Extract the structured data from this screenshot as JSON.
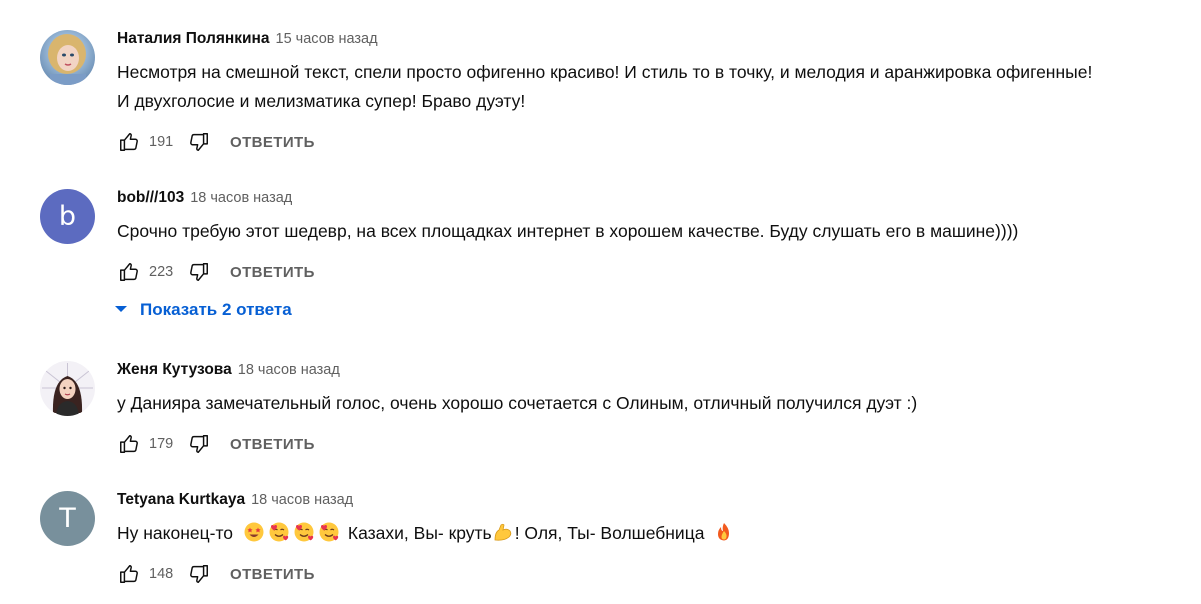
{
  "reply_label": "ОТВЕТИТЬ",
  "show_replies_label": "Показать 2 ответа",
  "comments": [
    {
      "author": "Наталия Полянкина",
      "time": "15 часов назад",
      "text_lines": [
        "Несмотря на смешной текст, спели просто офигенно красиво! И стиль то в точку, и мелодия и аранжировка офигенные!",
        "И двухголосие и мелизматика супер! Браво дуэту!"
      ],
      "likes": "191",
      "avatar": {
        "type": "photo",
        "icon": "woman-portrait-photo"
      }
    },
    {
      "author": "bob///103",
      "time": "18 часов назад",
      "text_lines": [
        "Срочно требую этот шедевр, на всех площадках интернет в хорошем качестве. Буду слушать его в машине))))"
      ],
      "likes": "223",
      "avatar": {
        "type": "letter",
        "letter": "b",
        "color": "#5c6bc0"
      }
    },
    {
      "author": "Женя Кутузова",
      "time": "18 часов назад",
      "text_lines": [
        "у Данияра замечательный голос, очень хорошо сочетается с Олиным, отличный получился дуэт :)"
      ],
      "likes": "179",
      "avatar": {
        "type": "drawing",
        "icon": "girl-illustration"
      }
    },
    {
      "author": "Tetyana Kurtkaya",
      "time": "18 часов назад",
      "text_parts": [
        "Ну наконец-то",
        "Казахи, Вы- круть",
        "! Оля, Ты- Волшебница"
      ],
      "emojis": [
        "star-struck-emoji",
        "smiling-face-with-hearts-emoji",
        "smiling-face-with-hearts-emoji",
        "smiling-face-with-hearts-emoji",
        "flexed-biceps-emoji",
        "fire-emoji"
      ],
      "likes": "148",
      "avatar": {
        "type": "letter",
        "letter": "T",
        "color": "#78909c"
      }
    }
  ],
  "icons": {
    "like": "thumbs-up-icon",
    "dislike": "thumbs-down-icon",
    "expand": "caret-down-icon"
  },
  "colors": {
    "link_blue": "#065fd4",
    "secondary_text": "#606060"
  }
}
